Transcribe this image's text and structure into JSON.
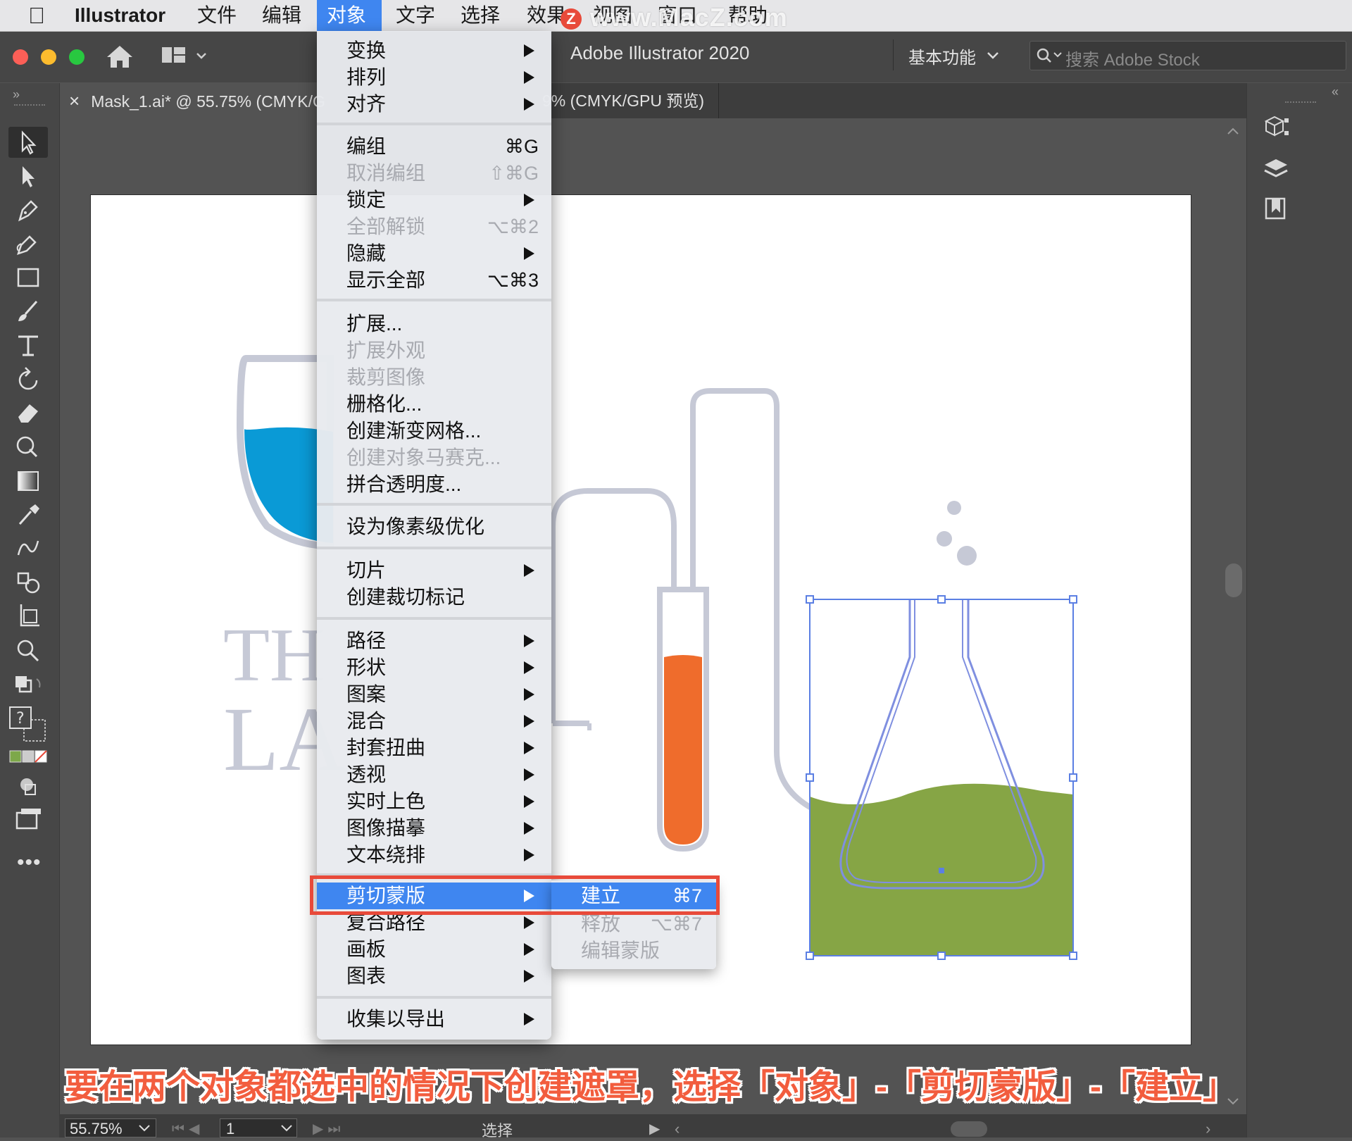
{
  "menubar": {
    "app_name": "Illustrator",
    "items": [
      "文件",
      "编辑",
      "对象",
      "文字",
      "选择",
      "效果",
      "视图",
      "窗口",
      "帮助"
    ],
    "watermark": "www.MacZ.com",
    "watermark_badge": "Z"
  },
  "appbar": {
    "title": "Adobe Illustrator 2020",
    "workspace": "基本功能",
    "stock_placeholder": "搜索 Adobe Stock"
  },
  "tabs": {
    "tab1": "Mask_1.ai* @ 55.75% (CMYK/G",
    "tab1_close": "×",
    "tab2": "9% (CMYK/GPU 预览)"
  },
  "object_menu": {
    "items": [
      {
        "label": "变换",
        "submenu": true
      },
      {
        "label": "排列",
        "submenu": true
      },
      {
        "label": "对齐",
        "submenu": true
      },
      {
        "label": "编组",
        "shortcut": "⌘G"
      },
      {
        "label": "取消编组",
        "shortcut": "⇧⌘G",
        "disabled": true
      },
      {
        "label": "锁定",
        "submenu": true
      },
      {
        "label": "全部解锁",
        "shortcut": "⌥⌘2",
        "disabled": true
      },
      {
        "label": "隐藏",
        "submenu": true
      },
      {
        "label": "显示全部",
        "shortcut": "⌥⌘3"
      },
      {
        "label": "扩展..."
      },
      {
        "label": "扩展外观",
        "disabled": true
      },
      {
        "label": "裁剪图像",
        "disabled": true
      },
      {
        "label": "栅格化..."
      },
      {
        "label": "创建渐变网格..."
      },
      {
        "label": "创建对象马赛克...",
        "disabled": true
      },
      {
        "label": "拼合透明度..."
      },
      {
        "label": "设为像素级优化"
      },
      {
        "label": "切片",
        "submenu": true
      },
      {
        "label": "创建裁切标记"
      },
      {
        "label": "路径",
        "submenu": true
      },
      {
        "label": "形状",
        "submenu": true
      },
      {
        "label": "图案",
        "submenu": true
      },
      {
        "label": "混合",
        "submenu": true
      },
      {
        "label": "封套扭曲",
        "submenu": true
      },
      {
        "label": "透视",
        "submenu": true
      },
      {
        "label": "实时上色",
        "submenu": true
      },
      {
        "label": "图像描摹",
        "submenu": true
      },
      {
        "label": "文本绕排",
        "submenu": true
      },
      {
        "label": "剪切蒙版",
        "submenu": true,
        "highlighted": true
      },
      {
        "label": "复合路径",
        "submenu": true
      },
      {
        "label": "画板",
        "submenu": true
      },
      {
        "label": "图表",
        "submenu": true
      },
      {
        "label": "收集以导出",
        "submenu": true
      }
    ]
  },
  "clip_submenu": {
    "items": [
      {
        "label": "建立",
        "shortcut": "⌘7",
        "highlighted": true
      },
      {
        "label": "释放",
        "shortcut": "⌥⌘7",
        "disabled": true
      },
      {
        "label": "编辑蒙版",
        "disabled": true
      }
    ]
  },
  "artwork": {
    "logo_line1": "TH",
    "logo_line2": "LA"
  },
  "statusbar": {
    "zoom": "55.75%",
    "page": "1",
    "mode": "选择"
  },
  "caption": "要在两个对象都选中的情况下创建遮罩，选择「对象」-「剪切蒙版」-「建立」",
  "colors": {
    "accent": "#3f86f0",
    "highlight_box": "#e84a3a",
    "caption": "#f25d3e",
    "flask_fill": "#86a545",
    "tube_fill": "#ef6c2c",
    "beaker_fill": "#0a9ad6",
    "line_art": "#c6c9d6"
  }
}
